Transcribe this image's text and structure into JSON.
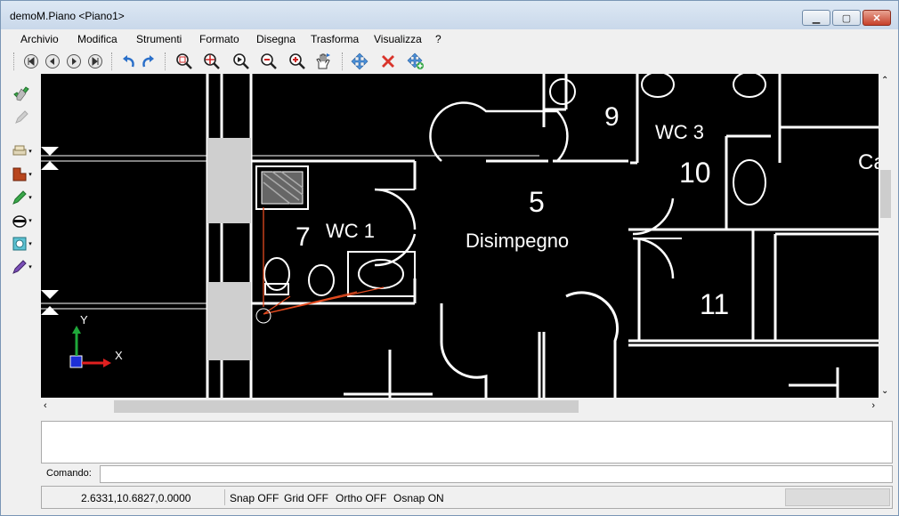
{
  "window": {
    "title": "demoM.Piano <Piano1>"
  },
  "menu": [
    "Archivio",
    "Modifica",
    "Strumenti",
    "Formato",
    "Disegna",
    "Trasforma",
    "Visualizza",
    "?"
  ],
  "drawing": {
    "rooms": [
      {
        "number": "5",
        "name": "Disimpegno"
      },
      {
        "number": "7",
        "name": "WC 1"
      },
      {
        "number": "9",
        "name": ""
      },
      {
        "number": "10",
        "name": "WC 3"
      },
      {
        "number": "11",
        "name": ""
      }
    ],
    "partial_label": "Ca",
    "axis_y": "Y",
    "axis_x": "X"
  },
  "command": {
    "label": "Comando:",
    "value": ""
  },
  "status": {
    "coords": "2.6331,10.6827,0.0000",
    "snap": "Snap OFF",
    "grid": "Grid OFF",
    "ortho": "Ortho OFF",
    "osnap": "Osnap ON"
  },
  "colors": {
    "canvas_bg": "#000000",
    "walls": "#ffffff",
    "fixtures": "#d9d9d9",
    "leader": "#e24a1f"
  }
}
